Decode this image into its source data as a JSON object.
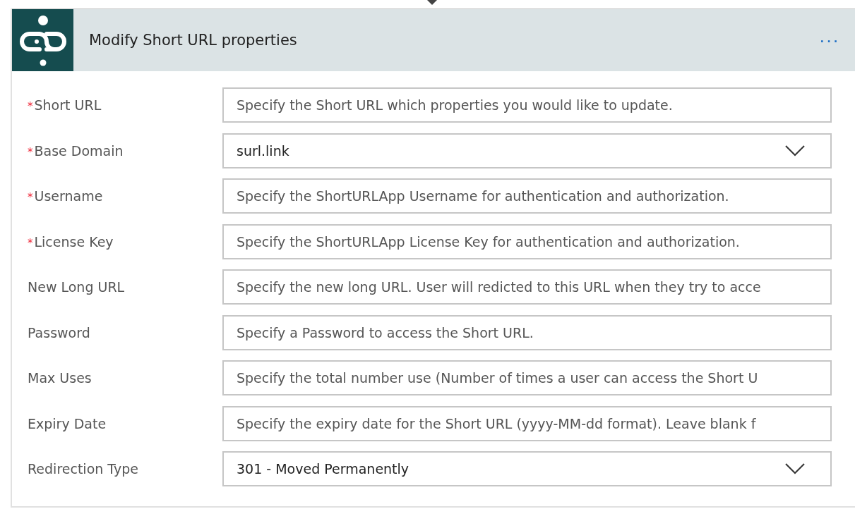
{
  "card": {
    "title": "Modify Short URL properties",
    "menu": "···"
  },
  "fields": [
    {
      "label": "Short URL",
      "required_mark": "*",
      "kind": "text",
      "placeholder": "Specify the Short URL which properties you would like to update."
    },
    {
      "label": "Base Domain",
      "required_mark": "*",
      "kind": "dropdown",
      "value": "surl.link"
    },
    {
      "label": "Username",
      "required_mark": "*",
      "kind": "text",
      "placeholder": "Specify the ShortURLApp Username for authentication and authorization."
    },
    {
      "label": "License Key",
      "required_mark": "*",
      "kind": "text",
      "placeholder": "Specify the ShortURLApp License Key for authentication and authorization."
    },
    {
      "label": "New Long URL",
      "kind": "text",
      "placeholder": "Specify the new long URL. User will redicted to this URL when they try to acce"
    },
    {
      "label": "Password",
      "kind": "text",
      "placeholder": "Specify a Password to access the Short URL."
    },
    {
      "label": "Max Uses",
      "kind": "text",
      "placeholder": "Specify the total number use (Number of times a user can access the Short U"
    },
    {
      "label": "Expiry Date",
      "kind": "text",
      "placeholder": "Specify the expiry date for the Short URL (yyyy-MM-dd format). Leave blank f"
    },
    {
      "label": "Redirection Type",
      "kind": "dropdown",
      "value": "301 - Moved Permanently"
    }
  ]
}
